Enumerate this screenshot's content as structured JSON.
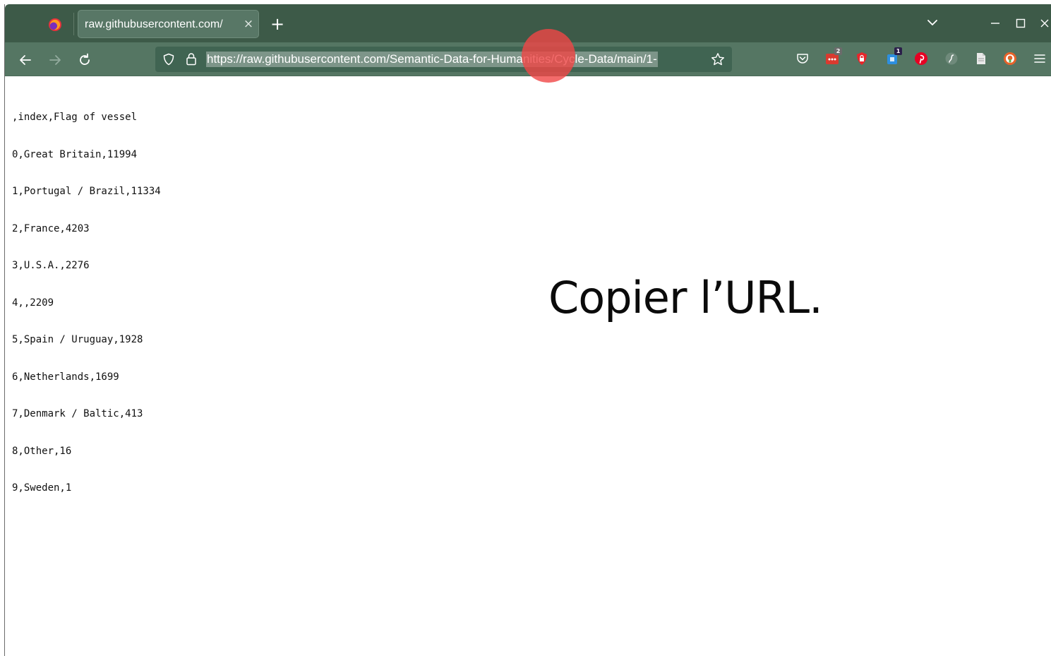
{
  "browser": {
    "tab": {
      "title": "raw.githubusercontent.com/",
      "close_glyph": "×",
      "favicon": "firefox-icon"
    },
    "new_tab_glyph": "+",
    "url": "https://raw.githubusercontent.com/Semantic-Data-for-Humanities/Cycle-Data/main/1-",
    "url_selected": true,
    "toolbar_extensions": [
      {
        "name": "pocket-icon",
        "badge": ""
      },
      {
        "name": "dots-extension-icon",
        "badge": "2"
      },
      {
        "name": "lock-extension-icon",
        "badge": ""
      },
      {
        "name": "bookmark-extension-icon",
        "badge": "1"
      },
      {
        "name": "pinterest-icon",
        "badge": ""
      },
      {
        "name": "script-extension-icon",
        "badge": ""
      },
      {
        "name": "reader-view-icon",
        "badge": ""
      },
      {
        "name": "duckduckgo-icon",
        "badge": ""
      }
    ],
    "colors": {
      "tabbar": "#3d5a48",
      "navbar": "#557663",
      "urlbar": "#406452",
      "url_highlight": "#7d9589"
    }
  },
  "page": {
    "csv_lines": [
      ",index,Flag of vessel",
      "0,Great Britain,11994",
      "1,Portugal / Brazil,11334",
      "2,France,4203",
      "3,U.S.A.,2276",
      "4,,2209",
      "5,Spain / Uruguay,1928",
      "6,Netherlands,1699",
      "7,Denmark / Baltic,413",
      "8,Other,16",
      "9,Sweden,1"
    ]
  },
  "overlay": {
    "caption": "Copier l’URL.",
    "click_marker_color": "#f04646"
  }
}
